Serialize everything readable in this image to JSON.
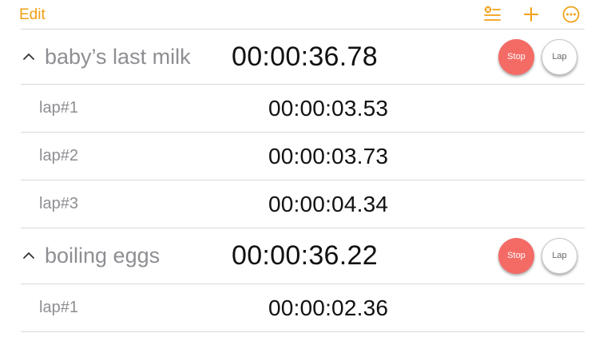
{
  "toolbar": {
    "edit_label": "Edit",
    "icons": [
      "checklist-delete-icon",
      "plus-icon",
      "more-icon"
    ],
    "accent_color": "#f0a013"
  },
  "timers": [
    {
      "name": "baby’s last milk",
      "elapsed": "00:00:36.78",
      "stop_label": "Stop",
      "lap_label": "Lap",
      "laps": [
        {
          "label": "lap#1",
          "time": "00:00:03.53"
        },
        {
          "label": "lap#2",
          "time": "00:00:03.73"
        },
        {
          "label": "lap#3",
          "time": "00:00:04.34"
        }
      ]
    },
    {
      "name": "boiling eggs",
      "elapsed": "00:00:36.22",
      "stop_label": "Stop",
      "lap_label": "Lap",
      "laps": [
        {
          "label": "lap#1",
          "time": "00:00:02.36"
        }
      ]
    }
  ],
  "colors": {
    "stop_button": "#f46b66",
    "separator": "#d9d9d9",
    "secondary_text": "#8e8e93"
  }
}
